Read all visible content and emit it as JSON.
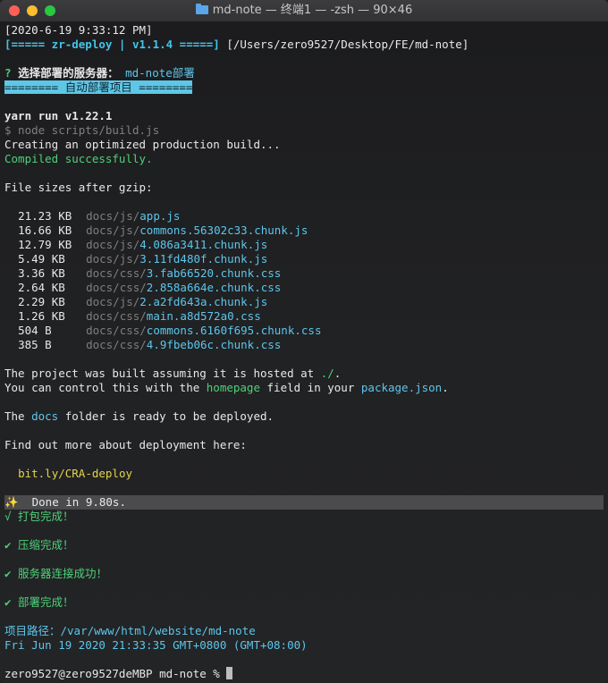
{
  "window": {
    "title": "md-note — 终端1 — -zsh — 90×46"
  },
  "terminal": {
    "timestamp": "[2020-6-19 9:33:12 PM]",
    "deploy_banner": "[===== zr-deploy | v1.1.4 =====]",
    "deploy_path": " [/Users/zero9527/Desktop/FE/md-note]",
    "prompt_q": "? ",
    "prompt_text": "选择部署的服务器：",
    "prompt_answer": " md-note部署",
    "section_banner": "======== 自动部署项目 ========",
    "yarn_line": "yarn run v1.22.1",
    "node_cmd": "$ node scripts/build.js",
    "creating": "Creating an optimized production build...",
    "compiled": "Compiled successfully.",
    "sizes_header": "File sizes after gzip:",
    "files": [
      {
        "size": "21.23 KB",
        "dir": "docs/js/",
        "name": "app.js"
      },
      {
        "size": "16.66 KB",
        "dir": "docs/js/",
        "name": "commons.56302c33.chunk.js"
      },
      {
        "size": "12.79 KB",
        "dir": "docs/js/",
        "name": "4.086a3411.chunk.js"
      },
      {
        "size": "5.49 KB",
        "dir": "docs/js/",
        "name": "3.11fd480f.chunk.js"
      },
      {
        "size": "3.36 KB",
        "dir": "docs/css/",
        "name": "3.fab66520.chunk.css"
      },
      {
        "size": "2.64 KB",
        "dir": "docs/css/",
        "name": "2.858a664e.chunk.css"
      },
      {
        "size": "2.29 KB",
        "dir": "docs/js/",
        "name": "2.a2fd643a.chunk.js"
      },
      {
        "size": "1.26 KB",
        "dir": "docs/css/",
        "name": "main.a8d572a0.css"
      },
      {
        "size": "504 B",
        "dir": "docs/css/",
        "name": "commons.6160f695.chunk.css"
      },
      {
        "size": "385 B",
        "dir": "docs/css/",
        "name": "4.9fbeb06c.chunk.css"
      }
    ],
    "built_1a": "The project was built assuming it is hosted at ",
    "built_1b": "./",
    "built_1c": ".",
    "built_2a": "You can control this with the ",
    "built_2b": "homepage",
    "built_2c": " field in your ",
    "built_2d": "package.json",
    "built_2e": ".",
    "docs_a": "The ",
    "docs_b": "docs",
    "docs_c": " folder is ready to be deployed.",
    "findout": "Find out more about deployment here:",
    "link": "bit.ly/CRA-deploy",
    "done": "✨  Done in 9.80s.",
    "step1": "√ 打包完成！",
    "step2": "✔ 压缩完成！",
    "step3": "✔ 服务器连接成功！",
    "step4": "✔ 部署完成！",
    "project_path": "项目路径：/var/www/html/website/md-note",
    "finish_time": "Fri Jun 19 2020 21:33:35 GMT+0800 (GMT+08:00)",
    "shell_prompt": "zero9527@zero9527deMBP md-note % "
  }
}
